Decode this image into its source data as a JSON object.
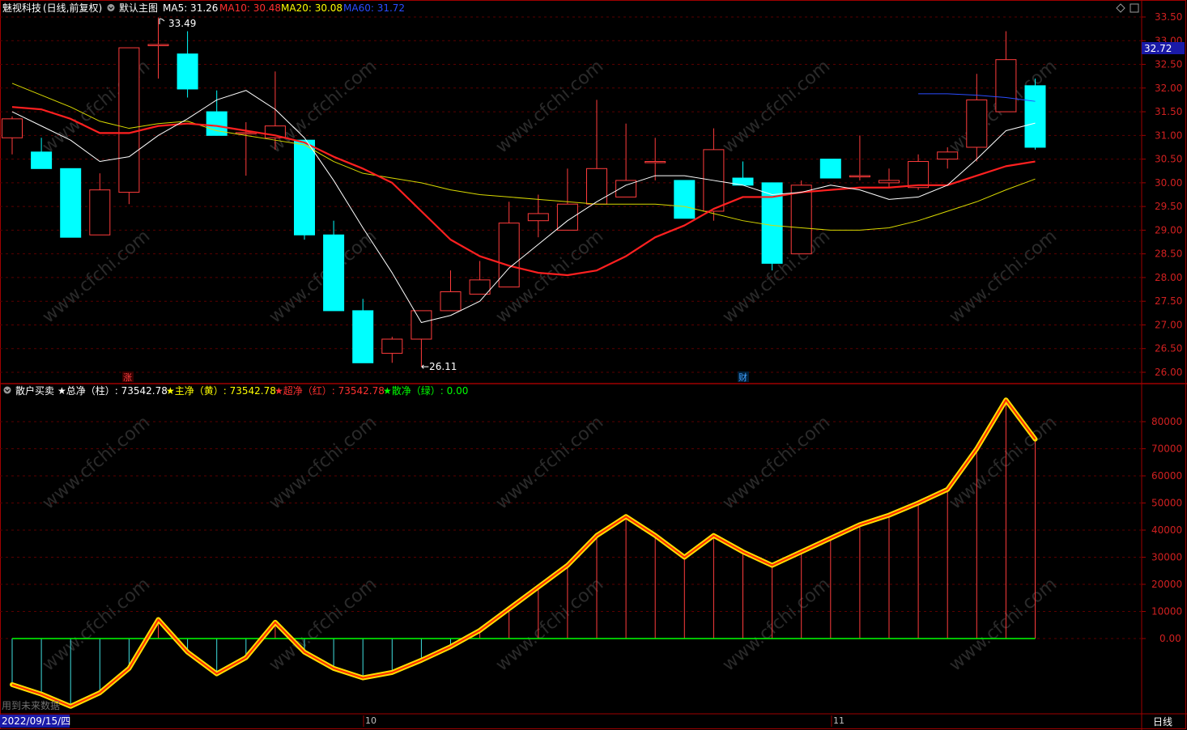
{
  "header": {
    "stock": "魅视科技",
    "period_mode": "(日线,前复权)",
    "template": "默认主图",
    "ma5": "MA5: 31.26",
    "ma10": "MA10: 30.48",
    "ma20": "MA20: 30.08",
    "ma60": "MA60: 31.72"
  },
  "indicator_header": {
    "name": "散户买卖",
    "total": "★总净（柱）: 73542.78",
    "main": "★主净（黄）: 73542.78",
    "super": "★超净（红）: 73542.78",
    "retail": "★散净（绿）: 0.00"
  },
  "colors": {
    "up": "#ff3c3c",
    "down": "#00ffff",
    "ma5": "#ffffff",
    "ma10": "#ff2020",
    "ma20": "#ffff00",
    "ma60": "#2040ff",
    "border": "#a00000"
  },
  "annotations": {
    "high_label": "33.49",
    "low_label": "←26.11",
    "price_tag": "32.72",
    "marker_zhang": "涨",
    "marker_cai": "财"
  },
  "watermark": "www.cfchi.com",
  "bottom": {
    "future_note": "用到未来数据",
    "date": "2022/09/15/四",
    "month_10": "10",
    "month_11": "11",
    "period_button": "日线"
  },
  "chart_data": [
    {
      "type": "candlestick",
      "title": "魅视科技 日线",
      "ylim": [
        25.85,
        33.6
      ],
      "yticks": [
        "33.50",
        "33.00",
        "32.50",
        "32.00",
        "31.50",
        "31.00",
        "30.50",
        "30.00",
        "29.50",
        "29.00",
        "28.50",
        "28.00",
        "27.50",
        "27.00",
        "26.50",
        "26.00"
      ],
      "candles": [
        {
          "o": 30.95,
          "h": 31.4,
          "l": 30.6,
          "c": 31.35
        },
        {
          "o": 30.65,
          "h": 30.95,
          "l": 30.3,
          "c": 30.3
        },
        {
          "o": 30.3,
          "h": 30.3,
          "l": 28.85,
          "c": 28.85
        },
        {
          "o": 28.9,
          "h": 30.2,
          "l": 28.9,
          "c": 29.85
        },
        {
          "o": 29.8,
          "h": 32.7,
          "l": 29.55,
          "c": 32.85
        },
        {
          "o": 32.92,
          "h": 33.49,
          "l": 32.2,
          "c": 32.92
        },
        {
          "o": 32.72,
          "h": 33.2,
          "l": 31.8,
          "c": 31.98
        },
        {
          "o": 31.5,
          "h": 31.95,
          "l": 31.0,
          "c": 31.0
        },
        {
          "o": 31.06,
          "h": 31.28,
          "l": 30.15,
          "c": 31.06
        },
        {
          "o": 30.95,
          "h": 32.35,
          "l": 30.7,
          "c": 31.2
        },
        {
          "o": 30.9,
          "h": 30.9,
          "l": 28.8,
          "c": 28.9
        },
        {
          "o": 28.9,
          "h": 29.2,
          "l": 27.3,
          "c": 27.3
        },
        {
          "o": 27.3,
          "h": 27.55,
          "l": 26.2,
          "c": 26.2
        },
        {
          "o": 26.4,
          "h": 26.75,
          "l": 26.2,
          "c": 26.7
        },
        {
          "o": 26.7,
          "h": 27.3,
          "l": 26.11,
          "c": 27.3
        },
        {
          "o": 27.3,
          "h": 28.15,
          "l": 27.3,
          "c": 27.7
        },
        {
          "o": 27.65,
          "h": 28.35,
          "l": 27.65,
          "c": 27.95
        },
        {
          "o": 27.8,
          "h": 29.6,
          "l": 27.8,
          "c": 29.15
        },
        {
          "o": 29.2,
          "h": 29.75,
          "l": 28.85,
          "c": 29.35
        },
        {
          "o": 29.0,
          "h": 30.3,
          "l": 29.0,
          "c": 29.55
        },
        {
          "o": 29.55,
          "h": 31.75,
          "l": 29.55,
          "c": 30.3
        },
        {
          "o": 29.7,
          "h": 31.25,
          "l": 29.7,
          "c": 30.05
        },
        {
          "o": 30.45,
          "h": 30.95,
          "l": 30.05,
          "c": 30.45
        },
        {
          "o": 30.05,
          "h": 30.05,
          "l": 29.25,
          "c": 29.25
        },
        {
          "o": 29.4,
          "h": 31.15,
          "l": 29.2,
          "c": 30.7
        },
        {
          "o": 30.1,
          "h": 30.45,
          "l": 29.95,
          "c": 29.95
        },
        {
          "o": 30.0,
          "h": 30.0,
          "l": 28.15,
          "c": 28.3
        },
        {
          "o": 28.5,
          "h": 30.05,
          "l": 28.5,
          "c": 29.95
        },
        {
          "o": 30.5,
          "h": 30.5,
          "l": 30.1,
          "c": 30.1
        },
        {
          "o": 30.15,
          "h": 31.0,
          "l": 30.05,
          "c": 30.15
        },
        {
          "o": 30.0,
          "h": 30.3,
          "l": 29.9,
          "c": 30.05
        },
        {
          "o": 29.9,
          "h": 30.6,
          "l": 29.85,
          "c": 30.45
        },
        {
          "o": 30.5,
          "h": 30.75,
          "l": 30.3,
          "c": 30.65
        },
        {
          "o": 30.75,
          "h": 32.3,
          "l": 30.45,
          "c": 31.75
        },
        {
          "o": 31.5,
          "h": 33.2,
          "l": 31.5,
          "c": 32.6
        },
        {
          "o": 32.05,
          "h": 32.2,
          "l": 30.7,
          "c": 30.75
        }
      ],
      "ma5": [
        31.5,
        31.2,
        30.9,
        30.45,
        30.55,
        31.0,
        31.35,
        31.75,
        31.95,
        31.55,
        30.95,
        30.05,
        29.05,
        28.1,
        27.05,
        27.2,
        27.5,
        28.2,
        28.7,
        29.2,
        29.6,
        29.95,
        30.15,
        30.15,
        30.05,
        29.95,
        29.75,
        29.8,
        29.95,
        29.85,
        29.65,
        29.7,
        29.95,
        30.5,
        31.1,
        31.26
      ],
      "ma10": [
        31.6,
        31.55,
        31.35,
        31.05,
        31.05,
        31.2,
        31.25,
        31.2,
        31.1,
        31.0,
        30.85,
        30.55,
        30.3,
        30.0,
        29.4,
        28.8,
        28.45,
        28.25,
        28.1,
        28.05,
        28.15,
        28.45,
        28.85,
        29.1,
        29.45,
        29.7,
        29.7,
        29.8,
        29.85,
        29.9,
        29.9,
        29.95,
        29.95,
        30.15,
        30.35,
        30.45
      ],
      "ma20": [
        32.1,
        31.85,
        31.6,
        31.3,
        31.15,
        31.25,
        31.3,
        31.1,
        31.0,
        30.9,
        30.8,
        30.45,
        30.2,
        30.1,
        30.0,
        29.85,
        29.75,
        29.7,
        29.65,
        29.6,
        29.55,
        29.55,
        29.55,
        29.5,
        29.35,
        29.2,
        29.1,
        29.05,
        29.0,
        29.0,
        29.05,
        29.2,
        29.4,
        29.6,
        29.85,
        30.08
      ],
      "ma60": [
        31.88,
        31.88,
        31.85,
        31.8,
        31.72
      ]
    },
    {
      "type": "bar+line",
      "title": "散户买卖",
      "ylim": [
        -27000,
        90000
      ],
      "yticks": [
        80000,
        70000,
        60000,
        50000,
        40000,
        30000,
        20000,
        10000,
        0
      ],
      "series": [
        {
          "name": "总净",
          "values": [
            -17000,
            -20500,
            -25000,
            -20000,
            -11000,
            7000,
            -5000,
            -13000,
            -7000,
            6000,
            -5000,
            -11000,
            -14500,
            -12500,
            -8000,
            -3000,
            3000,
            11000,
            19000,
            27000,
            38000,
            45000,
            38000,
            30000,
            38000,
            32000,
            27000,
            32000,
            37000,
            42000,
            45500,
            50000,
            55000,
            70000,
            88000,
            73542.78
          ]
        },
        {
          "name": "主净",
          "values": [
            -17000,
            -20500,
            -25000,
            -20000,
            -11000,
            7000,
            -5000,
            -13000,
            -7000,
            6000,
            -5000,
            -11000,
            -14500,
            -12500,
            -8000,
            -3000,
            3000,
            11000,
            19000,
            27000,
            38000,
            45000,
            38000,
            30000,
            38000,
            32000,
            27000,
            32000,
            37000,
            42000,
            45500,
            50000,
            55000,
            70000,
            88000,
            73542.78
          ]
        },
        {
          "name": "超净",
          "values": [
            -17000,
            -20500,
            -25000,
            -20000,
            -11000,
            7000,
            -5000,
            -13000,
            -7000,
            6000,
            -5000,
            -11000,
            -14500,
            -12500,
            -8000,
            -3000,
            3000,
            11000,
            19000,
            27000,
            38000,
            45000,
            38000,
            30000,
            38000,
            32000,
            27000,
            32000,
            37000,
            42000,
            45500,
            50000,
            55000,
            70000,
            88000,
            73542.78
          ]
        },
        {
          "name": "散净",
          "values": [
            0,
            0,
            0,
            0,
            0,
            0,
            0,
            0,
            0,
            0,
            0,
            0,
            0,
            0,
            0,
            0,
            0,
            0,
            0,
            0,
            0,
            0,
            0,
            0,
            0,
            0,
            0,
            0,
            0,
            0,
            0,
            0,
            0,
            0,
            0,
            0
          ]
        }
      ]
    }
  ]
}
